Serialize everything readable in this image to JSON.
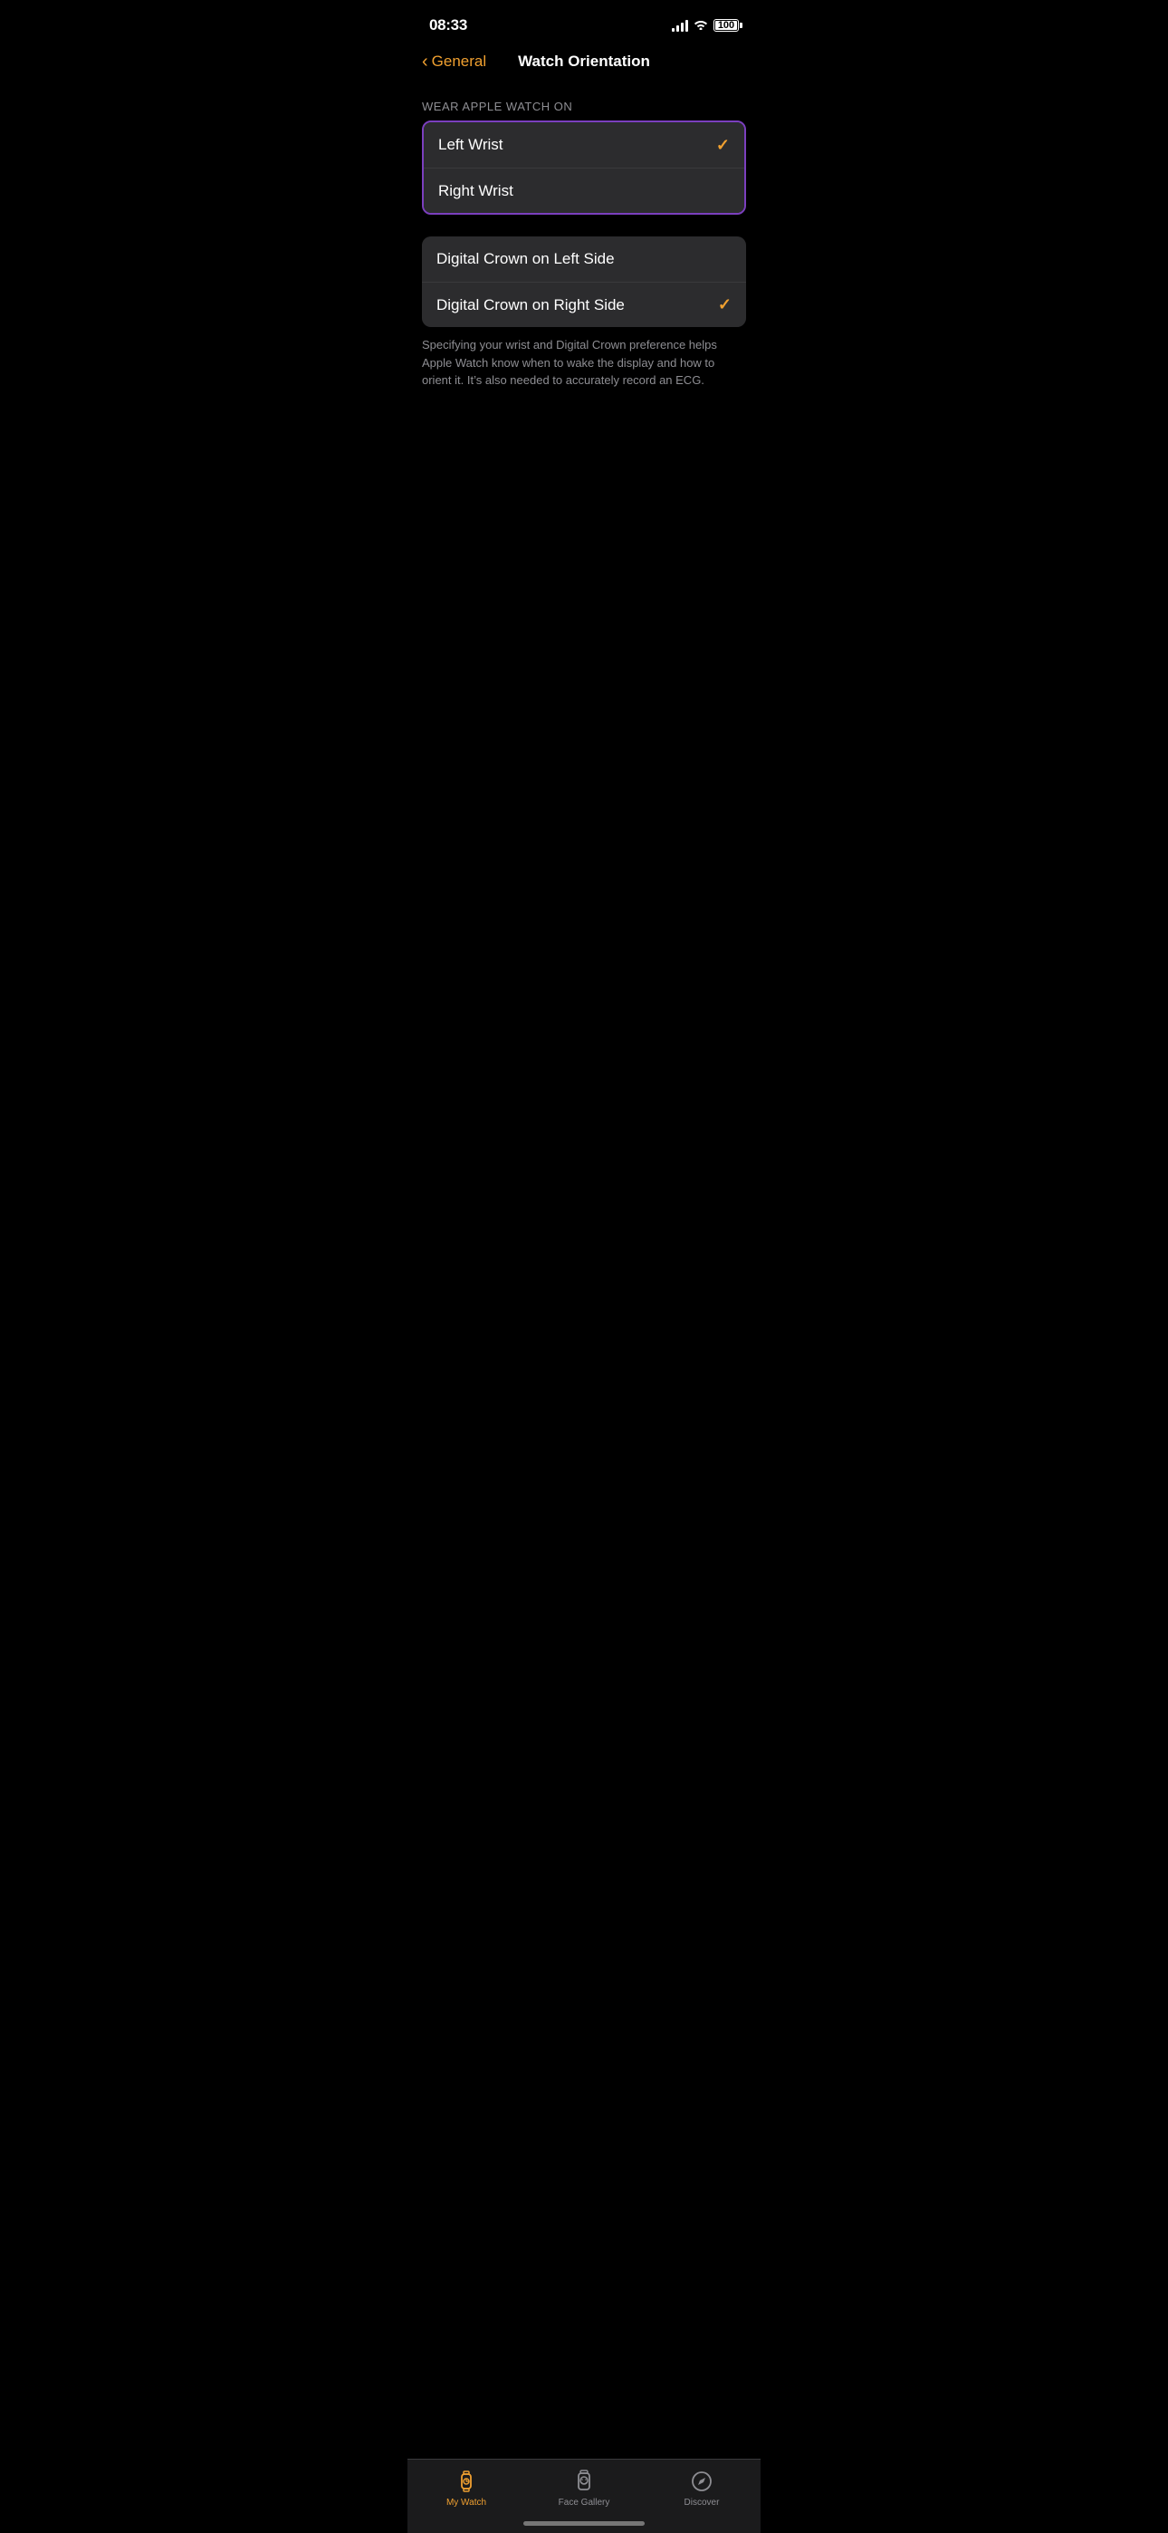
{
  "statusBar": {
    "time": "08:33",
    "battery": "100"
  },
  "navigation": {
    "backLabel": "General",
    "pageTitle": "Watch Orientation"
  },
  "sections": {
    "wristSection": {
      "label": "WEAR APPLE WATCH ON",
      "options": [
        {
          "label": "Left Wrist",
          "selected": true
        },
        {
          "label": "Right Wrist",
          "selected": false
        }
      ]
    },
    "crownSection": {
      "options": [
        {
          "label": "Digital Crown on Left Side",
          "selected": false
        },
        {
          "label": "Digital Crown on Right Side",
          "selected": true
        }
      ]
    },
    "footnote": "Specifying your wrist and Digital Crown preference helps Apple Watch know when to wake the display and how to orient it. It’s also needed to accurately record an ECG."
  },
  "tabBar": {
    "tabs": [
      {
        "id": "my-watch",
        "label": "My Watch",
        "active": true
      },
      {
        "id": "face-gallery",
        "label": "Face Gallery",
        "active": false
      },
      {
        "id": "discover",
        "label": "Discover",
        "active": false
      }
    ]
  }
}
